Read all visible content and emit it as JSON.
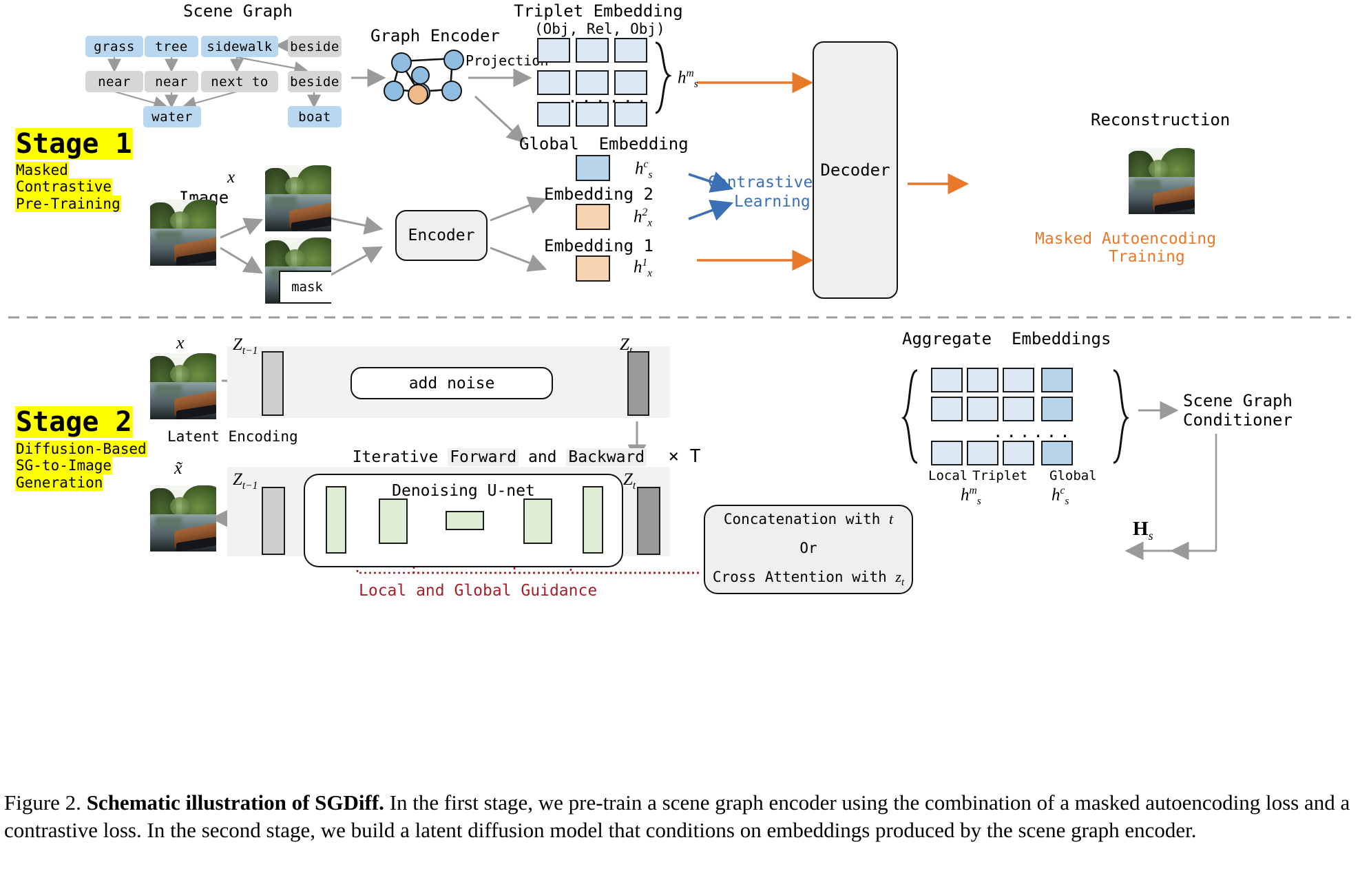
{
  "figure": {
    "caption_label": "Figure 2.",
    "caption_bold": "Schematic illustration of SGDiff.",
    "caption_rest": "In the first stage, we pre-train a scene graph encoder using the combination of a masked autoencoding loss and a contrastive loss. In the second stage, we build a latent diffusion model that conditions on embeddings produced by the scene graph encoder."
  },
  "colors": {
    "object_node": "#b9d7ef",
    "relation_node": "#d6d6d6",
    "embedding_light_blue": "#dce9f5",
    "embedding_blue": "#b8d4ea",
    "embedding_peach": "#f7d3b4",
    "unet_green": "#dfedd7",
    "latent_grey": "#cfcfcf",
    "latent_dark_grey": "#9a9a9a",
    "orange_arrow": "#e8792a",
    "blue_arrow": "#3b6fb6",
    "red_guidance": "#a81f28",
    "highlight_yellow": "#ffff00",
    "panel_grey": "#f2f2f2"
  },
  "stage1": {
    "title": "Stage 1",
    "subtitle_lines": [
      "Masked",
      "Contrastive",
      "Pre-Training"
    ],
    "scene_graph_title": "Scene Graph",
    "graph_nodes": {
      "objects_row1": [
        "grass",
        "tree",
        "sidewalk"
      ],
      "relation_row1_right": "beside",
      "relations_row2": [
        "near",
        "near",
        "next to",
        "beside"
      ],
      "objects_row3": [
        "water",
        "boat"
      ]
    },
    "graph_encoder_title": "Graph Encoder",
    "projection_label": "Projection",
    "triplet_title_line1": "Triplet Embedding",
    "triplet_title_line2": "(Obj, Rel, Obj)",
    "triplet_ellipsis": "......",
    "triplet_symbol": "h",
    "triplet_symbol_sup": "m",
    "triplet_symbol_sub": "s",
    "global_embedding_title": "Global  Embedding",
    "global_symbol": "h",
    "global_symbol_sup": "c",
    "global_symbol_sub": "s",
    "image_label": "Image",
    "image_label_var": "x",
    "mask_label": "mask",
    "encoder_label": "Encoder",
    "embedding2_label": "Embedding 2",
    "embedding2_symbol": "h",
    "embedding2_sup": "2",
    "embedding2_sub": "x",
    "embedding1_label": "Embedding 1",
    "embedding1_symbol": "h",
    "embedding1_sup": "1",
    "embedding1_sub": "x",
    "contrastive_line1": "Contrastive",
    "contrastive_line2": "Learning",
    "decoder_label": "Decoder",
    "reconstruction_label": "Reconstruction",
    "mae_line1": "Masked Autoencoding",
    "mae_line2": "Training"
  },
  "stage2": {
    "title": "Stage 2",
    "subtitle_lines": [
      "Diffusion-Based",
      "SG-to-Image",
      "Generation"
    ],
    "input_var": "x",
    "output_var": "x̃",
    "z_prev_label": "Z",
    "z_prev_sub": "t−1",
    "z_t_label": "Z",
    "z_t_sub": "t",
    "add_noise_label": "add noise",
    "latent_encoding_label": "Latent Encoding",
    "iterative_parts": [
      "Iterative ",
      "Forward",
      " and ",
      "Backward",
      "  × T"
    ],
    "unet_label": "Denoising U-net",
    "guidance_label": "Local and Global Guidance",
    "aggregate_title": "Aggregate  Embeddings",
    "aggregate_ellipsis": "......",
    "agg_label_local": "Local",
    "agg_label_triplet": "Triplet",
    "agg_label_global": "Global",
    "agg_sym_local_triplet": "h",
    "agg_sym_local_triplet_sup": "m",
    "agg_sym_local_triplet_sub": "s",
    "agg_sym_global": "h",
    "agg_sym_global_sup": "c",
    "agg_sym_global_sub": "s",
    "conditioner_line1": "Scene Graph",
    "conditioner_line2": "Conditioner",
    "hs_symbol": "H",
    "hs_sub": "s",
    "cond_box_line1_a": "Concatenation with ",
    "cond_box_line1_b": "t",
    "cond_box_line2": "Or",
    "cond_box_line3_a": "Cross Attention with ",
    "cond_box_line3_b": "z",
    "cond_box_line3_sub": "t"
  }
}
